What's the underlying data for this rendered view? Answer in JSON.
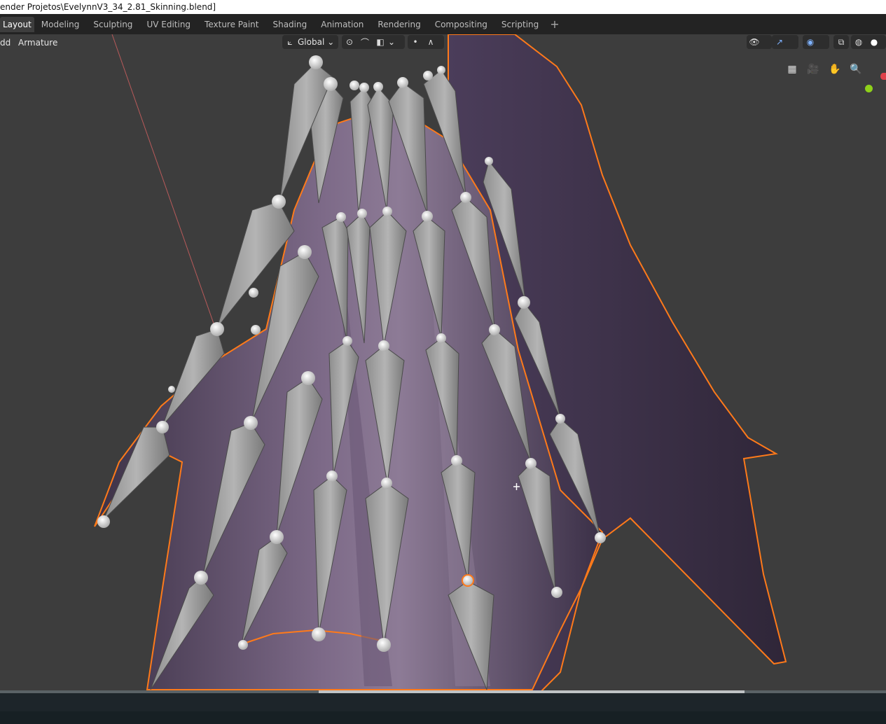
{
  "window": {
    "title": "ender Projetos\\EvelynnV3_34_2.81_Skinning.blend]"
  },
  "workspace_tabs": [
    {
      "label": "Layout",
      "active": true
    },
    {
      "label": "Modeling",
      "active": false
    },
    {
      "label": "Sculpting",
      "active": false
    },
    {
      "label": "UV Editing",
      "active": false
    },
    {
      "label": "Texture Paint",
      "active": false
    },
    {
      "label": "Shading",
      "active": false
    },
    {
      "label": "Animation",
      "active": false
    },
    {
      "label": "Rendering",
      "active": false
    },
    {
      "label": "Compositing",
      "active": false
    },
    {
      "label": "Scripting",
      "active": false
    }
  ],
  "workspace_add": "+",
  "viewport_header": {
    "menu_add": "dd",
    "menu_armature": "Armature",
    "transform_orientation": "Global"
  },
  "timeline": {
    "scroll_fraction_start": 0.36,
    "scroll_fraction_end": 0.84
  },
  "colors": {
    "viewport_bg": "#3d3d3d",
    "bone_fill": "#a9a9a9",
    "mesh_purple": "#5b4a6b",
    "selection_outline": "#ff7a1a",
    "axis_line": "#b85a5a",
    "active_indicator": "#8fd11a"
  }
}
